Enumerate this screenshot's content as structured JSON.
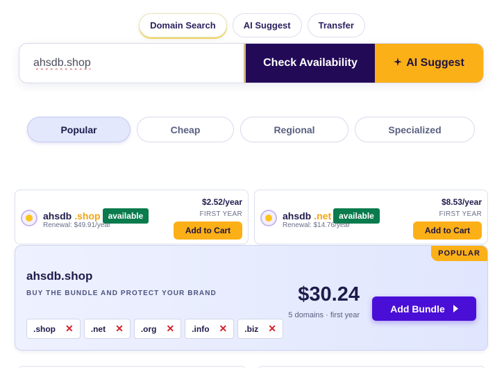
{
  "mode_tabs": [
    {
      "label": "Domain Search",
      "active": true
    },
    {
      "label": "AI Suggest",
      "active": false
    },
    {
      "label": "Transfer",
      "active": false
    }
  ],
  "search": {
    "value": "ahsdb.shop",
    "check_label": "Check Availability",
    "ai_label": "AI Suggest",
    "ai_icon": "sparkle-icon"
  },
  "categories": [
    {
      "label": "Popular",
      "active": true
    },
    {
      "label": "Cheap",
      "active": false
    },
    {
      "label": "Regional",
      "active": false
    },
    {
      "label": "Specialized",
      "active": false
    }
  ],
  "results": [
    {
      "name": "ahsdb",
      "tld": ".shop",
      "status": "available",
      "renewal": "Renewal: $49.91/year",
      "price": "$2.52/year",
      "first_year": "FIRST YEAR",
      "cart_label": "Add to Cart"
    },
    {
      "name": "ahsdb",
      "tld": ".net",
      "status": "available",
      "renewal": "Renewal: $14.76/year",
      "price": "$8.53/year",
      "first_year": "FIRST YEAR",
      "cart_label": "Add to Cart"
    }
  ],
  "bundle": {
    "badge": "POPULAR",
    "title": "ahsdb.shop",
    "subtitle": "BUY THE BUNDLE AND PROTECT YOUR BRAND",
    "tlds": [
      ".shop",
      ".net",
      ".org",
      ".info",
      ".biz"
    ],
    "remove_glyph": "✕",
    "price": "$30.24",
    "meta": "5 domains · first year",
    "button_label": "Add Bundle"
  },
  "colors": {
    "primary_dark": "#230a57",
    "accent_yellow": "#fbb017",
    "available_green": "#0a7b4d",
    "bundle_button": "#4a0fd6"
  }
}
